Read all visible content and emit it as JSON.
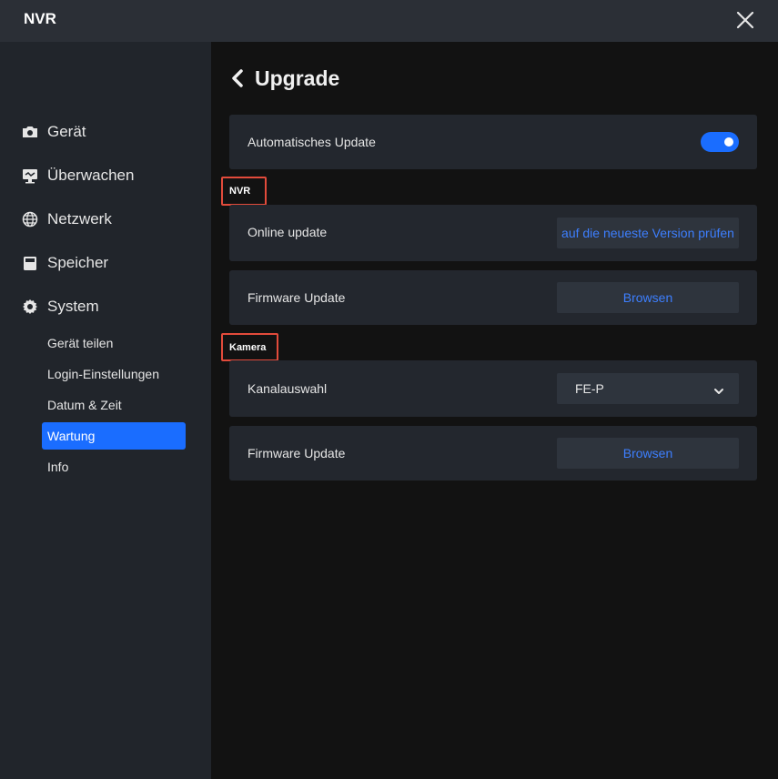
{
  "window": {
    "title": "NVR"
  },
  "sidebar": {
    "items": [
      {
        "label": "Gerät",
        "icon": "camera-icon"
      },
      {
        "label": "Überwachen",
        "icon": "monitor-icon"
      },
      {
        "label": "Netzwerk",
        "icon": "globe-icon"
      },
      {
        "label": "Speicher",
        "icon": "storage-icon"
      },
      {
        "label": "System",
        "icon": "gear-icon"
      }
    ],
    "system_subitems": [
      {
        "label": "Gerät teilen"
      },
      {
        "label": "Login-Einstellungen"
      },
      {
        "label": "Datum & Zeit"
      },
      {
        "label": "Wartung",
        "active": true
      },
      {
        "label": "Info"
      }
    ]
  },
  "main": {
    "title": "Upgrade",
    "auto_update": {
      "label": "Automatisches Update",
      "enabled": true
    },
    "nvr_section": {
      "label": "NVR",
      "online_update": {
        "label": "Online update",
        "button": "auf die neueste Version prüfen"
      },
      "firmware_update": {
        "label": "Firmware Update",
        "button": "Browsen"
      }
    },
    "camera_section": {
      "label": "Kamera",
      "channel_select": {
        "label": "Kanalauswahl",
        "value": "FE-P"
      },
      "firmware_update": {
        "label": "Firmware Update",
        "button": "Browsen"
      }
    }
  },
  "colors": {
    "accent": "#1a6dff",
    "link_text": "#3d7fff",
    "highlight_box": "#e24b3b",
    "sidebar_bg": "#21252b",
    "card_bg": "#23272e",
    "main_bg": "#121212"
  }
}
